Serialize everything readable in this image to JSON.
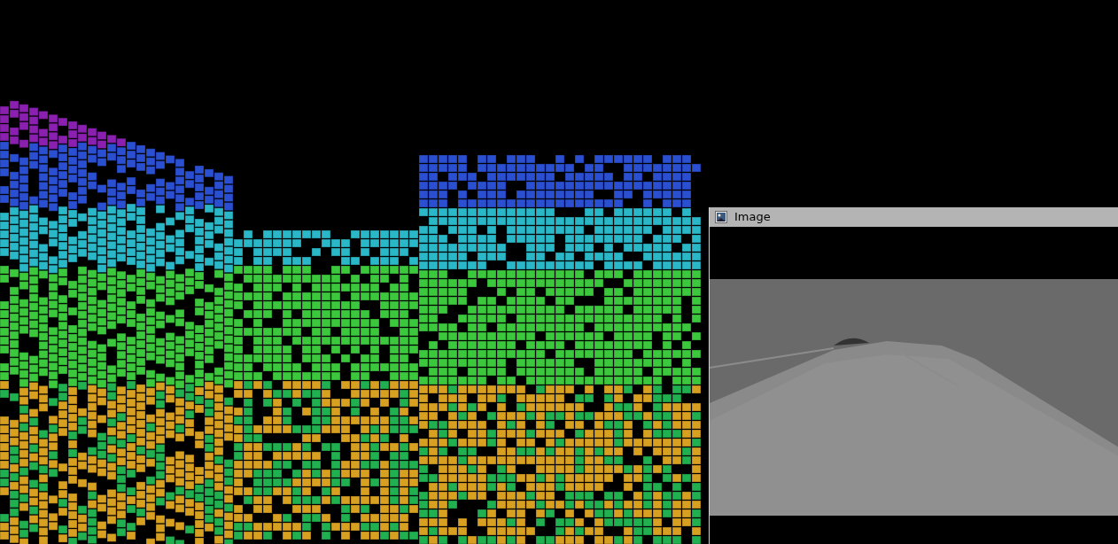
{
  "image_panel": {
    "title": "Image"
  }
}
